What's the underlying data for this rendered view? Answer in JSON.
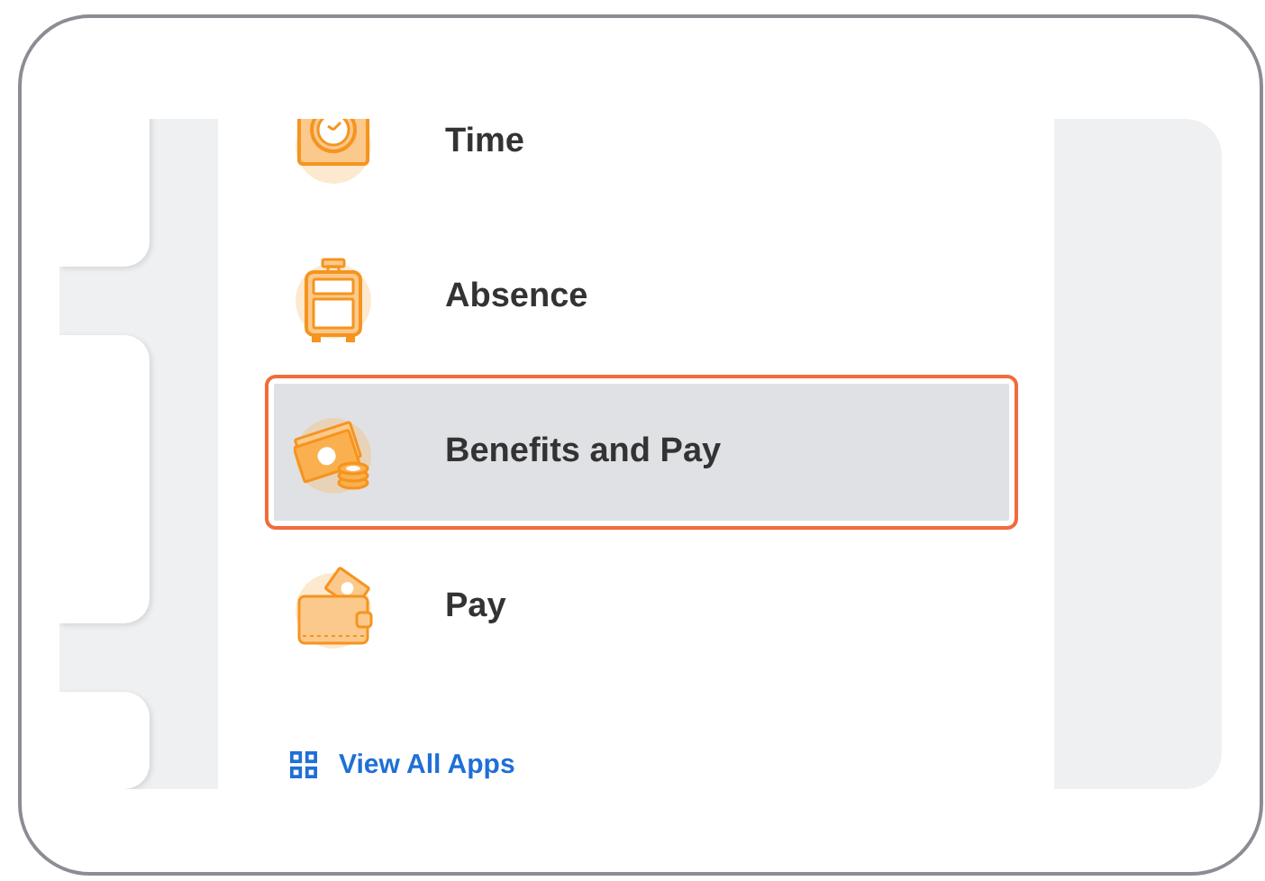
{
  "apps": [
    {
      "label": "Time",
      "kind": "clock",
      "selected": false
    },
    {
      "label": "Absence",
      "kind": "suitcase",
      "selected": false
    },
    {
      "label": "Benefits and Pay",
      "kind": "money",
      "selected": true
    },
    {
      "label": "Pay",
      "kind": "wallet",
      "selected": false
    }
  ],
  "view_all": {
    "label": "View All Apps"
  }
}
